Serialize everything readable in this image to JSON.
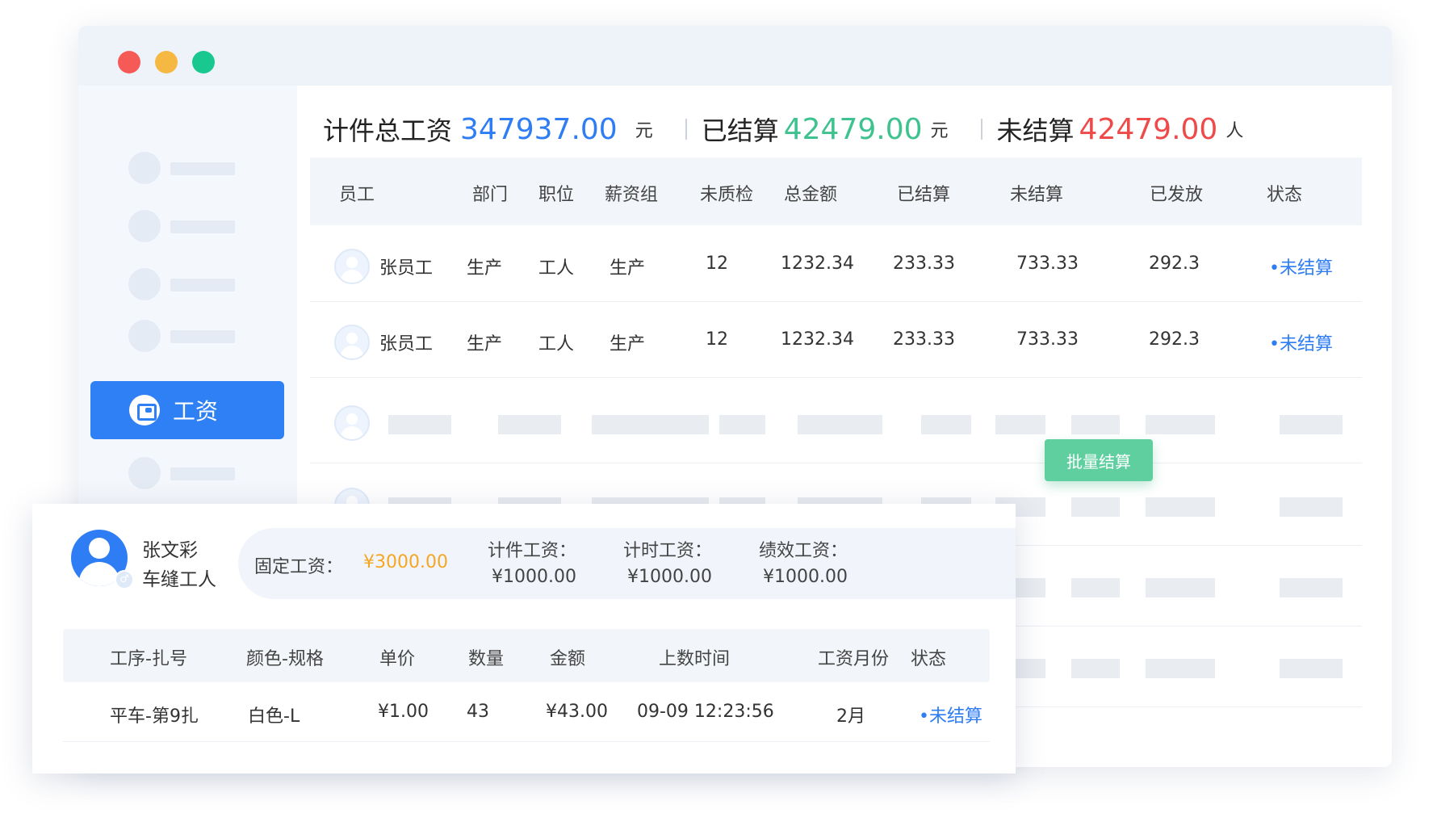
{
  "summary": {
    "total_label": "计件总工资",
    "total_value": "347937.00",
    "total_unit": "元",
    "settled_label": "已结算",
    "settled_value": "42479.00",
    "settled_unit": "元",
    "unsettled_label": "未结算",
    "unsettled_value": "42479.00",
    "unsettled_unit": "人"
  },
  "colors": {
    "accent": "#2f80f5",
    "settled": "#3ec28f",
    "unsettled": "#ee4a4a",
    "orange": "#f5a623",
    "batch": "#5fcf9f"
  },
  "sidebar": {
    "active_label": "工资",
    "active_icon": "wallet-icon"
  },
  "table": {
    "headers": [
      "员工",
      "部门",
      "职位",
      "薪资组",
      "未质检",
      "总金额",
      "已结算",
      "未结算",
      "已发放",
      "状态"
    ],
    "rows": [
      [
        "张员工",
        "生产",
        "工人",
        "生产",
        "12",
        "1232.34",
        "233.33",
        "733.33",
        "292.3",
        "•未结算"
      ],
      [
        "张员工",
        "生产",
        "工人",
        "生产",
        "12",
        "1232.34",
        "233.33",
        "733.33",
        "292.3",
        "•未结算"
      ]
    ]
  },
  "batch_button": "批量结算",
  "card": {
    "name": "张文彩",
    "role": "车缝工人",
    "fixed_label": "固定工资：",
    "fixed_value": "¥3000.00",
    "piece_label": "计件工资：",
    "piece_value": "¥1000.00",
    "hourly_label": "计时工资：",
    "hourly_value": "¥1000.00",
    "perf_label": "绩效工资：",
    "perf_value": "¥1000.00",
    "headers": [
      "工序-扎号",
      "颜色-规格",
      "单价",
      "数量",
      "金额",
      "上数时间",
      "工资月份",
      "状态"
    ],
    "row": [
      "平车-第9扎",
      "白色-L",
      "¥1.00",
      "43",
      "¥43.00",
      "09-09 12:23:56",
      "2月",
      "•未结算"
    ]
  }
}
